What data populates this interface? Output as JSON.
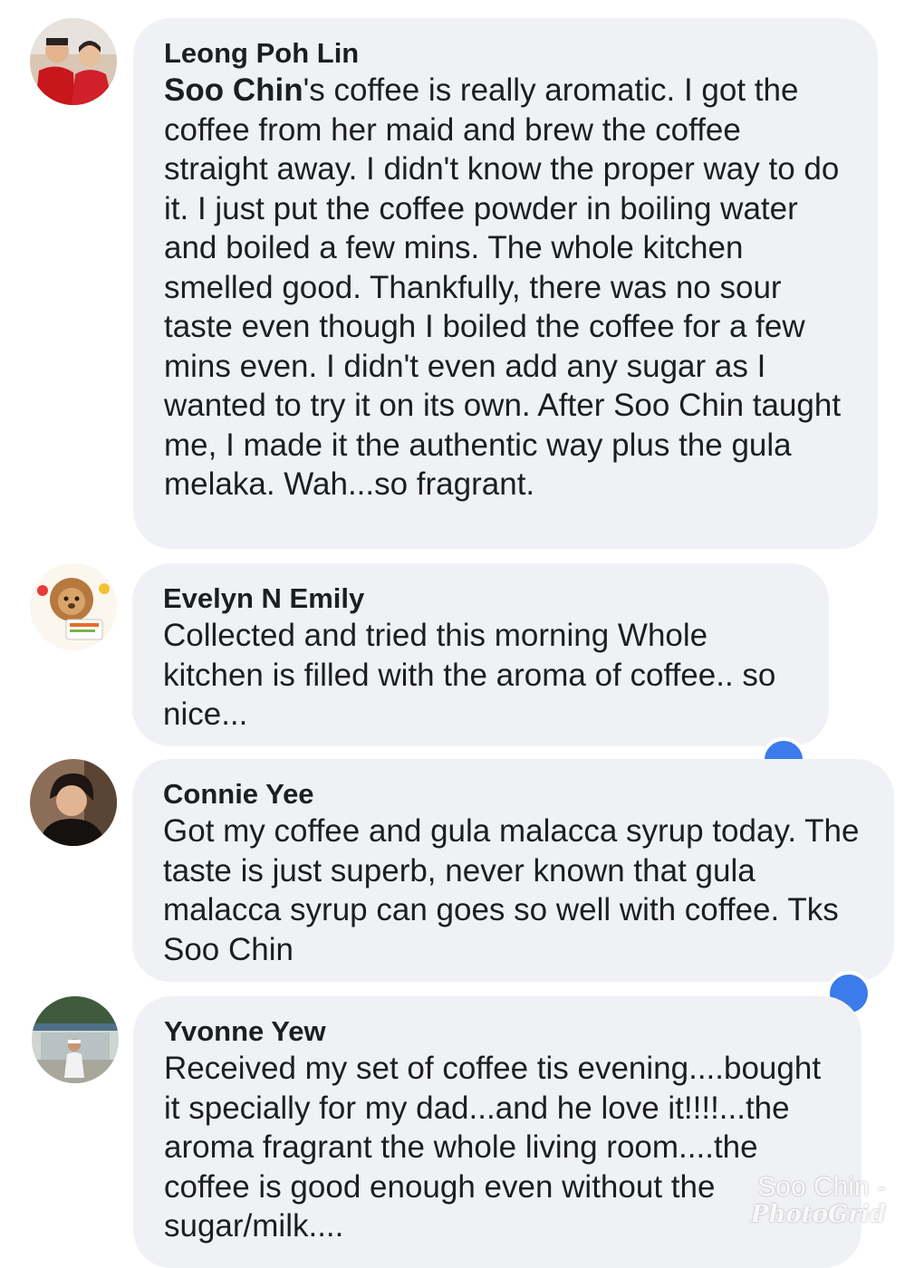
{
  "comments": [
    {
      "author": "Leong Poh Lin",
      "mention": "Soo Chin",
      "text": "'s coffee is really aromatic. I got the coffee from her maid and brew the coffee straight away. I didn't know the proper way to do it. I just put the coffee powder in boiling water and boiled a few mins. The whole kitchen smelled good. Thankfully, there was no sour taste even though I boiled the coffee for a few mins even. I didn't even add any sugar as I wanted to try it on its own. After Soo Chin taught me, I made it the authentic way plus the gula melaka. Wah...so fragrant.",
      "avatar_icon": "two-people-avatar"
    },
    {
      "author": "Evelyn N Emily",
      "text": "Collected and tried this morning Whole kitchen is filled with the aroma of coffee.. so nice...",
      "avatar_icon": "lion-mascot-avatar"
    },
    {
      "author": "Connie Yee",
      "text": "Got my coffee and gula malacca syrup today. The taste is just superb, never known that gula malacca syrup can goes so well with coffee. Tks Soo Chin",
      "avatar_icon": "person-portrait-avatar"
    },
    {
      "author": "Yvonne Yew",
      "text": "Received my set of coffee tis evening....bought it specially for my dad...and he love it!!!!...the aroma fragrant the whole living room....the coffee is good enough even without the sugar/milk....",
      "avatar_icon": "person-outdoor-avatar"
    }
  ],
  "watermark": {
    "line1": "Soo Chin -",
    "line2": "PhotoGrid"
  },
  "colors": {
    "bubble": "#f0f1f4",
    "text": "#1c1e21",
    "reaction": "#3b7bea"
  }
}
